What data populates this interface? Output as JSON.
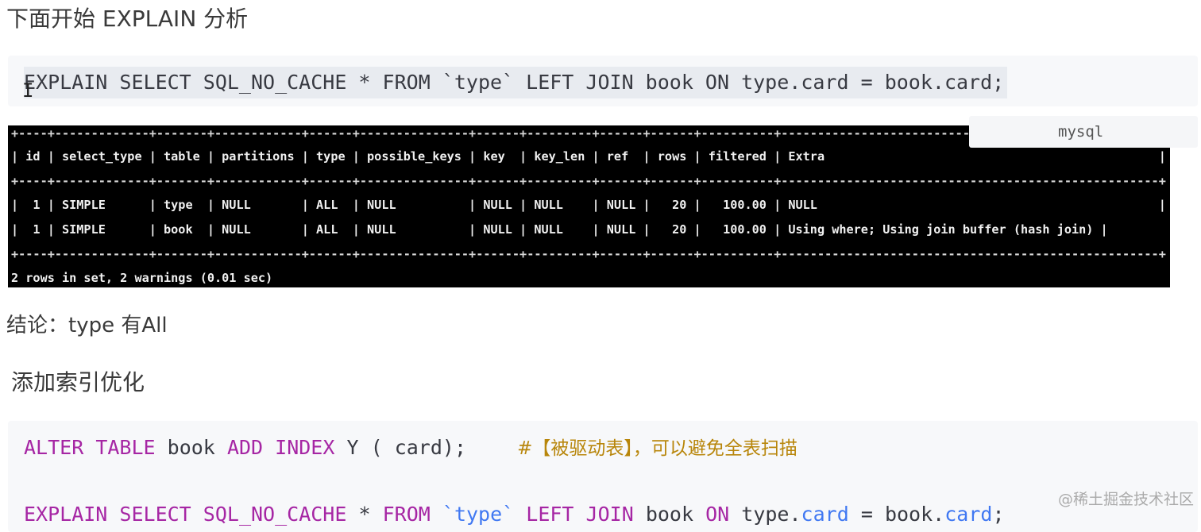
{
  "heading1": "下面开始 EXPLAIN 分析",
  "code1": "EXPLAIN SELECT SQL_NO_CACHE * FROM `type` LEFT JOIN book ON type.card = book.card;",
  "lang_label": "mysql",
  "terminal": {
    "border": "+----+-------------+-------+------------+------+---------------+------+---------+------+------+----------+----------------------------------------------------+",
    "header": "| id | select_type | table | partitions | type | possible_keys | key  | key_len | ref  | rows | filtered | Extra                                              |",
    "row1": "|  1 | SIMPLE      | type  | NULL       | ALL  | NULL          | NULL | NULL    | NULL |   20 |   100.00 | NULL                                               |",
    "row2": "|  1 | SIMPLE      | book  | NULL       | ALL  | NULL          | NULL | NULL    | NULL |   20 |   100.00 | Using where; Using join buffer (hash join) |",
    "footer": "2 rows in set, 2 warnings (0.01 sec)"
  },
  "conclusion": "结论：type 有All",
  "heading2": "添加索引优化",
  "code2": {
    "alter_kw1": "ALTER",
    "alter_kw2": "TABLE",
    "alter_tbl": "book",
    "alter_kw3": "ADD",
    "alter_kw4": "INDEX",
    "alter_rest": "Y ( card);",
    "comment": "#【被驱动表】，可以避免全表扫描",
    "explain_kw1": "EXPLAIN",
    "explain_kw2": "SELECT",
    "explain_kw3": "SQL_NO_CACHE",
    "explain_star": "*",
    "explain_kw4": "FROM",
    "explain_type": "`type`",
    "explain_kw5": "LEFT",
    "explain_kw6": "JOIN",
    "explain_book": "book",
    "explain_kw7": "ON",
    "explain_t": "type.",
    "explain_card1": "card",
    "explain_eq": "=",
    "explain_b": "book.",
    "explain_card2": "card",
    "explain_end": ";"
  },
  "watermark": "@稀土掘金技术社区"
}
